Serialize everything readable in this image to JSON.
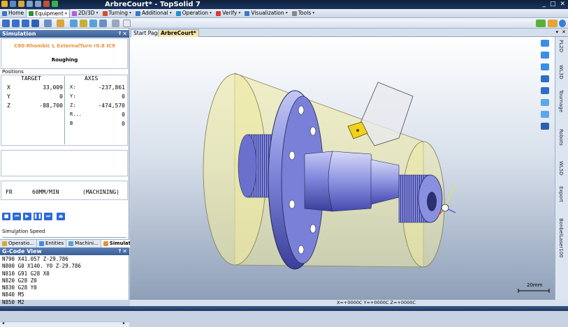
{
  "app": {
    "title": "ArbreCourt* - TopSolid 7",
    "window_controls": [
      "_",
      "□",
      "✕"
    ]
  },
  "menu": {
    "tabs": [
      {
        "label": "Home",
        "icon_color": "#3a77c4"
      },
      {
        "label": "Equipment",
        "icon_color": "#2f8f3a",
        "active": true
      },
      {
        "label": "2D/3D",
        "icon_color": "#b35fd1"
      },
      {
        "label": "Turning",
        "icon_color": "#d44d2a"
      },
      {
        "label": "Additional",
        "icon_color": "#3a77c4"
      },
      {
        "label": "Operation",
        "icon_color": "#1c8fd0"
      },
      {
        "label": "Verify",
        "icon_color": "#d43a3a"
      },
      {
        "label": "Visualization",
        "icon_color": "#3a77c4"
      },
      {
        "label": "Tools",
        "icon_color": "#888888"
      }
    ]
  },
  "simulation": {
    "panel_title": "Simulation",
    "tool_name": "C80-Rhombic L ExternalTurn r0.8 IC9",
    "mode": "Roughing",
    "positions_label": "Positions",
    "target_header": "TARGET",
    "axis_header": "AXIS",
    "target": [
      {
        "axis": "X",
        "value": "33,009"
      },
      {
        "axis": "Y",
        "value": "0"
      },
      {
        "axis": "Z",
        "value": "-88,700"
      }
    ],
    "machine": [
      {
        "axis": "X:",
        "value": "-237,861"
      },
      {
        "axis": "Y:",
        "value": "0"
      },
      {
        "axis": "Z:",
        "value": "-474,570"
      },
      {
        "axis": "R...",
        "value": "0"
      },
      {
        "axis": "B",
        "value": "0"
      }
    ],
    "feed_label": "FR",
    "feed_value": "60MM/MIN",
    "feed_status": "(MACHINING)",
    "speed_label": "Simulation Speed",
    "speed_tick": "∨"
  },
  "panel_tabs": [
    {
      "label": "Operatio...",
      "active": false
    },
    {
      "label": "Entities",
      "active": false
    },
    {
      "label": "Machini...",
      "active": false
    },
    {
      "label": "Simulat...",
      "active": true
    }
  ],
  "gcode": {
    "panel_title": "G-Code View",
    "lines": [
      "N790 X41.057 Z-29.786",
      "N800 G0 X140. Y0 Z-29.786",
      "N810 G91 G28 X0",
      "N820 G28 Z0",
      "N830 G28 Y0",
      "N840 M5",
      "N850 M2",
      "%"
    ]
  },
  "documents": {
    "tabs": [
      {
        "label": "Start Page",
        "active": false
      },
      {
        "label": "ArbreCourt*",
        "active": true
      }
    ]
  },
  "right_tabs": [
    "PL2D",
    "WL3D",
    "Tournage",
    "Robots",
    "WL5D",
    "Export",
    "BonbelLaser100"
  ],
  "scale": {
    "label": "20mm"
  },
  "status": {
    "coords": "X=+0000C Y=+0000C Z=+0000C"
  },
  "colors": {
    "accent": "#3a5e96",
    "part": "#7077d6",
    "stock": "#e7e8a0",
    "insert": "#f2d21a"
  }
}
